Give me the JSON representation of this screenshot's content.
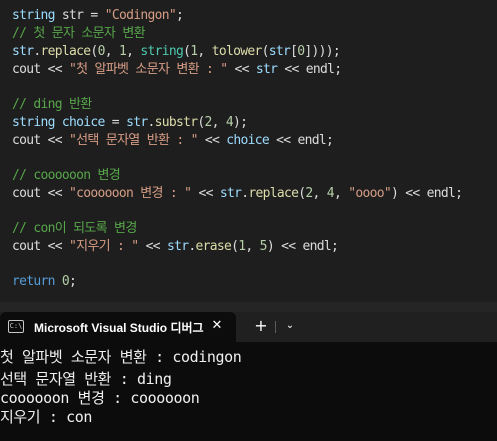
{
  "editor": {
    "lines": [
      [
        [
          "id",
          "string"
        ],
        [
          "plain",
          " "
        ],
        [
          "plain",
          "str"
        ],
        [
          "plain",
          " = "
        ],
        [
          "str",
          "\"Codingon\""
        ],
        [
          "plain",
          ";"
        ]
      ],
      [
        [
          "cm",
          "// 첫 문자 소문자 변환"
        ]
      ],
      [
        [
          "id",
          "str"
        ],
        [
          "plain",
          "."
        ],
        [
          "fn",
          "replace"
        ],
        [
          "plain",
          "("
        ],
        [
          "num",
          "0"
        ],
        [
          "plain",
          ", "
        ],
        [
          "num",
          "1"
        ],
        [
          "plain",
          ", "
        ],
        [
          "ty",
          "string"
        ],
        [
          "plain",
          "("
        ],
        [
          "num",
          "1"
        ],
        [
          "plain",
          ", "
        ],
        [
          "fn",
          "tolower"
        ],
        [
          "plain",
          "("
        ],
        [
          "id",
          "str"
        ],
        [
          "plain",
          "["
        ],
        [
          "num",
          "0"
        ],
        [
          "plain",
          "])));"
        ]
      ],
      [
        [
          "plain",
          "cout << "
        ],
        [
          "str",
          "\"첫 알파벳 소문자 변환 : \""
        ],
        [
          "plain",
          " << "
        ],
        [
          "id",
          "str"
        ],
        [
          "plain",
          " << endl;"
        ]
      ],
      [],
      [
        [
          "cm",
          "// ding 반환"
        ]
      ],
      [
        [
          "id",
          "string"
        ],
        [
          "plain",
          " "
        ],
        [
          "id",
          "choice"
        ],
        [
          "plain",
          " = "
        ],
        [
          "id",
          "str"
        ],
        [
          "plain",
          "."
        ],
        [
          "fn",
          "substr"
        ],
        [
          "plain",
          "("
        ],
        [
          "num",
          "2"
        ],
        [
          "plain",
          ", "
        ],
        [
          "num",
          "4"
        ],
        [
          "plain",
          ");"
        ]
      ],
      [
        [
          "plain",
          "cout << "
        ],
        [
          "str",
          "\"선택 문자열 반환 : \""
        ],
        [
          "plain",
          " << "
        ],
        [
          "id",
          "choice"
        ],
        [
          "plain",
          " << endl;"
        ]
      ],
      [],
      [
        [
          "cm",
          "// coooooon 변경"
        ]
      ],
      [
        [
          "plain",
          "cout << "
        ],
        [
          "str",
          "\"coooooon 변경 : \""
        ],
        [
          "plain",
          " << "
        ],
        [
          "id",
          "str"
        ],
        [
          "plain",
          "."
        ],
        [
          "fn",
          "replace"
        ],
        [
          "plain",
          "("
        ],
        [
          "num",
          "2"
        ],
        [
          "plain",
          ", "
        ],
        [
          "num",
          "4"
        ],
        [
          "plain",
          ", "
        ],
        [
          "str",
          "\"oooo\""
        ],
        [
          "plain",
          ") << endl;"
        ]
      ],
      [],
      [
        [
          "cm",
          "// con이 되도록 변경"
        ]
      ],
      [
        [
          "plain",
          "cout << "
        ],
        [
          "str",
          "\"지우기 : \""
        ],
        [
          "plain",
          " << "
        ],
        [
          "id",
          "str"
        ],
        [
          "plain",
          "."
        ],
        [
          "fn",
          "erase"
        ],
        [
          "plain",
          "("
        ],
        [
          "num",
          "1"
        ],
        [
          "plain",
          ", "
        ],
        [
          "num",
          "5"
        ],
        [
          "plain",
          ") << endl;"
        ]
      ],
      [],
      [
        [
          "kw",
          "return"
        ],
        [
          "plain",
          " "
        ],
        [
          "num",
          "0"
        ],
        [
          "plain",
          ";"
        ]
      ]
    ]
  },
  "terminal_tab": {
    "icon_label": "C:\\",
    "title": "Microsoft Visual Studio 디버그",
    "close_symbol": "✕",
    "new_tab_symbol": "+",
    "dropdown_symbol": "⌄"
  },
  "terminal": {
    "output_lines": [
      "첫 알파벳 소문자 변환 : codingon",
      "선택 문자열 반환 : ding",
      "coooooon 변경 : coooooon",
      "지우기 : con"
    ]
  },
  "colors": {
    "editor_bg": "#1e1e1e",
    "terminal_bg": "#0c0c0c",
    "tabbar_bg": "#202020",
    "keyword": "#569cd6",
    "string": "#d69d85",
    "comment": "#57a64a",
    "identifier": "#9cdcfe",
    "function": "#dcdcaa",
    "number": "#b5cea8"
  }
}
